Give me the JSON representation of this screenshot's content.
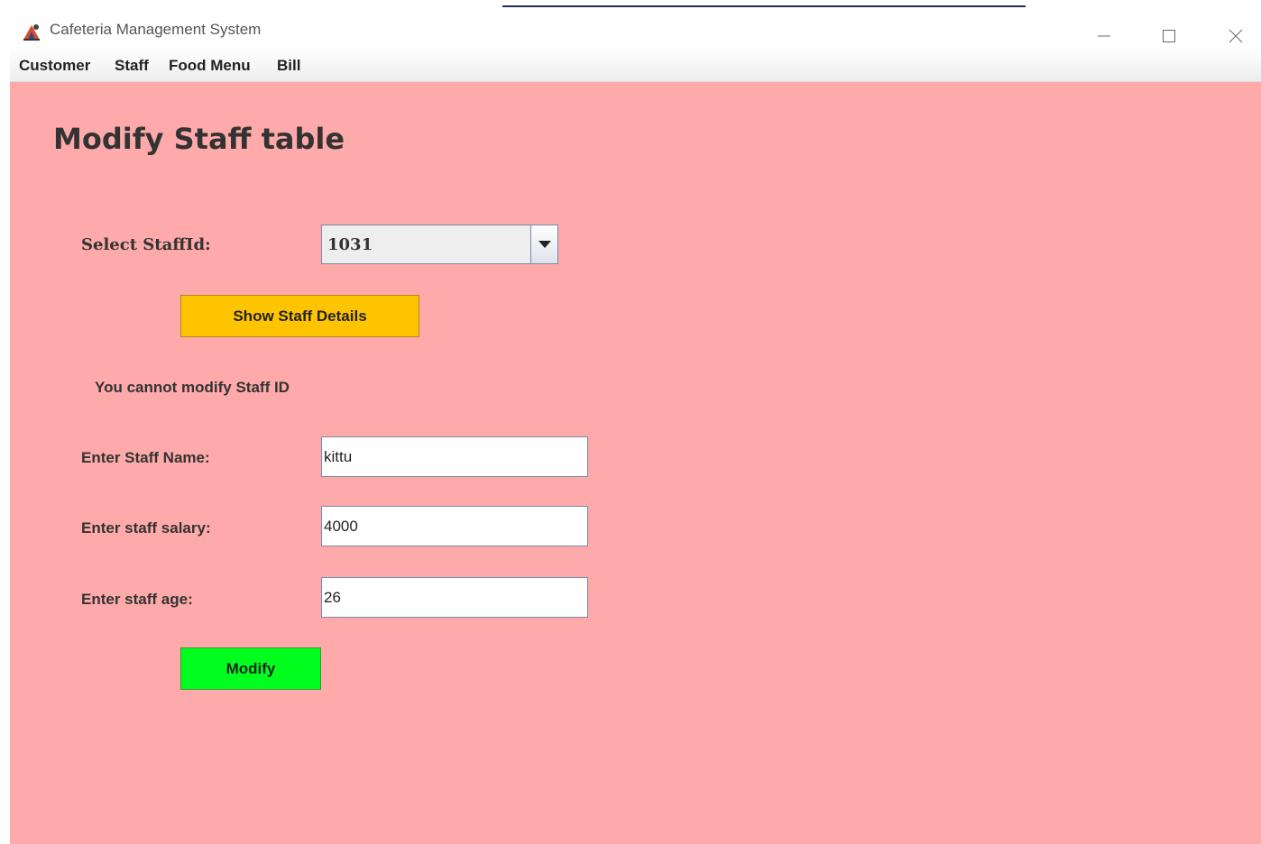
{
  "window": {
    "title": "Cafeteria Management System",
    "controls": {
      "minimize_icon": "minimize-icon",
      "maximize_icon": "maximize-icon",
      "close_icon": "close-icon"
    }
  },
  "menu": {
    "items": [
      {
        "label": "Customer"
      },
      {
        "label": "Staff"
      },
      {
        "label": "Food Menu"
      },
      {
        "label": "Bill"
      }
    ]
  },
  "form": {
    "heading": "Modify Staff table",
    "select_label": "Select StaffId:",
    "selected_staff_id": "1031",
    "show_button_label": "Show Staff Details",
    "notice": "You cannot modify Staff ID",
    "name_label": "Enter Staff Name:",
    "name_value": "kittu",
    "salary_label": "Enter staff salary:",
    "salary_value": "4000",
    "age_label": "Enter staff age:",
    "age_value": "26",
    "modify_button_label": "Modify"
  },
  "colors": {
    "background": "#ffaaaa",
    "show_button": "#ffc400",
    "modify_button": "#00ff1e"
  }
}
